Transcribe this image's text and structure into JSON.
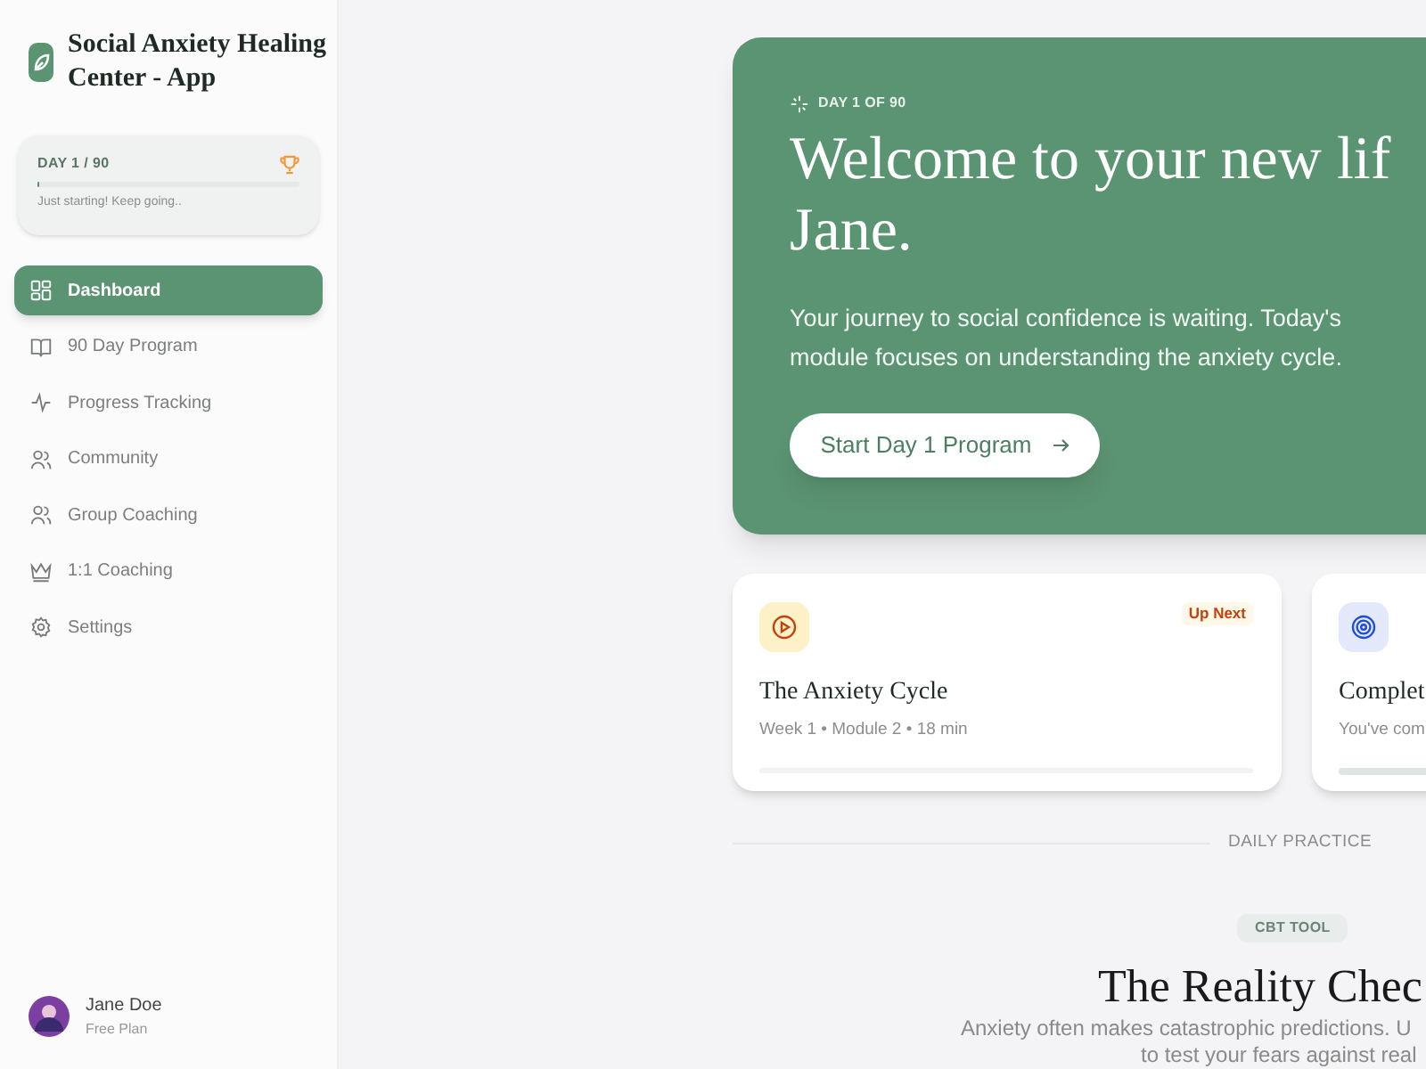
{
  "app": {
    "title": "Social Anxiety Healing Center - App"
  },
  "progress_card": {
    "label": "DAY 1 / 90",
    "level": 0.01,
    "note": "Just starting! Keep going.."
  },
  "nav": [
    {
      "label": "Dashboard",
      "kind": "grid",
      "selected": true
    },
    {
      "label": "90 Day Program",
      "kind": "book",
      "selected": false
    },
    {
      "label": "Progress Tracking",
      "kind": "pulse",
      "selected": false
    },
    {
      "label": "Community",
      "kind": "users",
      "selected": false
    },
    {
      "label": "Group Coaching",
      "kind": "users",
      "selected": false
    },
    {
      "label": "1:1 Coaching",
      "kind": "crown",
      "selected": false
    },
    {
      "label": "Settings",
      "kind": "gear",
      "selected": false
    }
  ],
  "user": {
    "name": "Jane Doe",
    "plan": "Free Plan"
  },
  "hero": {
    "eyebrow": "DAY 1 OF 90",
    "title_lines": [
      "Welcome to your new lif",
      "Jane."
    ],
    "text": "Your journey to social confidence is waiting. Today's module focuses on understanding the anxiety cycle.",
    "button": "Start Day 1 Program"
  },
  "modules": [
    {
      "kind": "play",
      "badge": "Up Next",
      "title": "The Anxiety Cycle",
      "meta": "Week 1 • Module 2 • 18 min"
    },
    {
      "kind": "target",
      "title": "Complet",
      "meta": "You've com"
    }
  ],
  "section": {
    "label": "DAILY PRACTICE"
  },
  "tool": {
    "badge": "CBT TOOL",
    "title": "The Reality Chec",
    "description_lines": [
      "Anxiety often makes catastrophic predictions. U",
      "to test your fears against real"
    ]
  }
}
